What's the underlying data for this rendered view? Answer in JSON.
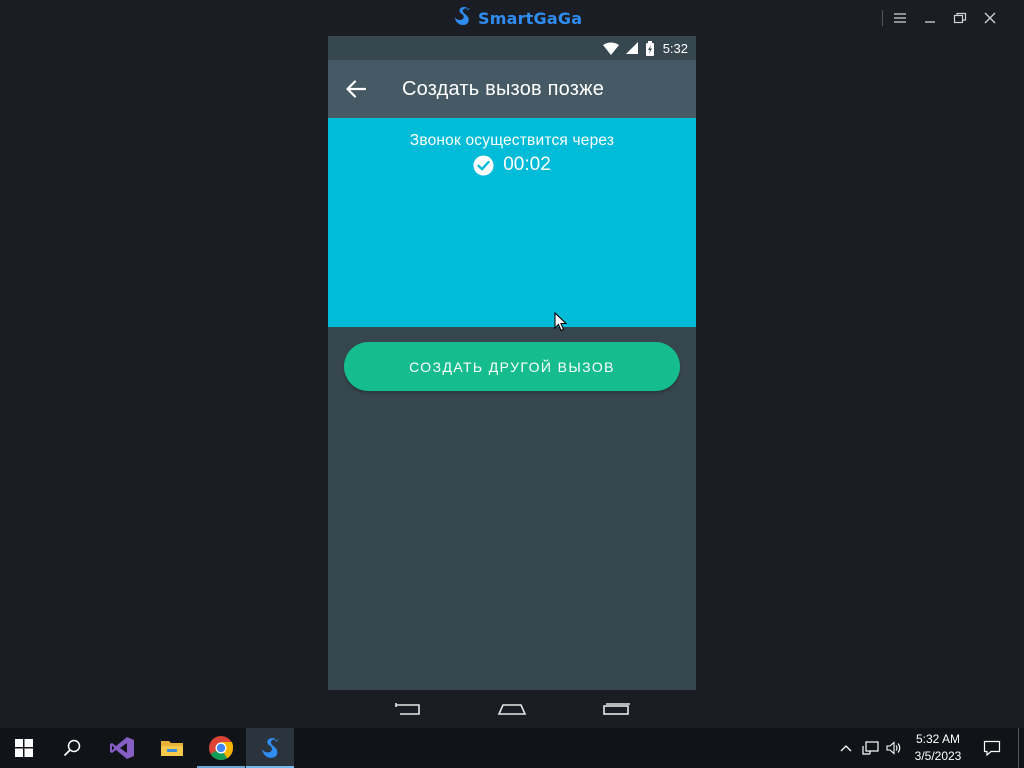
{
  "emulator": {
    "brand": "SmartGaGa",
    "window_controls": [
      "menu",
      "minimize",
      "restore",
      "close"
    ]
  },
  "phone": {
    "status_bar": {
      "time": "5:32",
      "icons": [
        "wifi-icon",
        "signal-icon",
        "battery-charging-icon"
      ]
    },
    "app_bar": {
      "title": "Создать вызов позже",
      "back_icon": "arrow-back-icon"
    },
    "call_panel": {
      "label": "Звонок осуществится через",
      "timer": "00:02",
      "status_icon": "check-circle-icon",
      "background": "#00bcd9"
    },
    "action_button": {
      "label": "СОЗДАТЬ ДРУГОЙ ВЫЗОВ",
      "color": "#15bd8e"
    },
    "nav_buttons": [
      "back",
      "home",
      "recents"
    ]
  },
  "taskbar": {
    "apps": [
      "windows-start",
      "search",
      "visual-studio",
      "file-explorer",
      "chrome",
      "smartgaga"
    ],
    "active_app": "smartgaga",
    "clock": {
      "time": "5:32 AM",
      "date": "3/5/2023"
    }
  },
  "colors": {
    "desktop": "#1b1d25",
    "phone_bg": "#37474f",
    "app_bar": "#455a64",
    "accent": "#2f8cf0"
  }
}
